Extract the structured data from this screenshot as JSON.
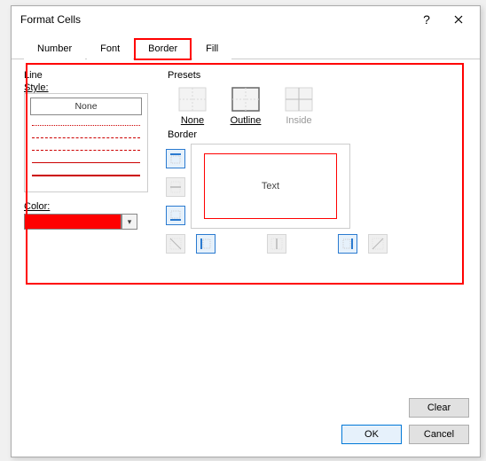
{
  "window": {
    "title": "Format Cells",
    "help_glyph": "?",
    "close_glyph": "✕"
  },
  "tabs": [
    {
      "label": "Number",
      "key": "number"
    },
    {
      "label": "Font",
      "key": "font"
    },
    {
      "label": "Border",
      "key": "border",
      "active": true,
      "highlighted": true
    },
    {
      "label": "Fill",
      "key": "fill"
    }
  ],
  "line": {
    "title": "Line",
    "style_label": "Style:",
    "none_label": "None",
    "color_label": "Color:",
    "color_value": "#ff0000",
    "dropdown_glyph": "▾"
  },
  "presets": {
    "title": "Presets",
    "items": [
      {
        "label": "None",
        "key": "none",
        "enabled": true
      },
      {
        "label": "Outline",
        "key": "outline",
        "enabled": true
      },
      {
        "label": "Inside",
        "key": "inside",
        "enabled": false
      }
    ]
  },
  "border": {
    "title": "Border",
    "preview_text": "Text",
    "side_buttons": [
      {
        "key": "top",
        "selected": true
      },
      {
        "key": "h-mid",
        "selected": false,
        "disabled": true
      },
      {
        "key": "bottom",
        "selected": true
      }
    ],
    "bottom_buttons": [
      {
        "key": "diag-down",
        "disabled": true
      },
      {
        "key": "left",
        "selected": true
      },
      {
        "key": "v-mid",
        "disabled": true
      },
      {
        "key": "right",
        "selected": true
      },
      {
        "key": "diag-up",
        "disabled": true
      }
    ]
  },
  "buttons": {
    "clear": "Clear",
    "ok": "OK",
    "cancel": "Cancel"
  }
}
